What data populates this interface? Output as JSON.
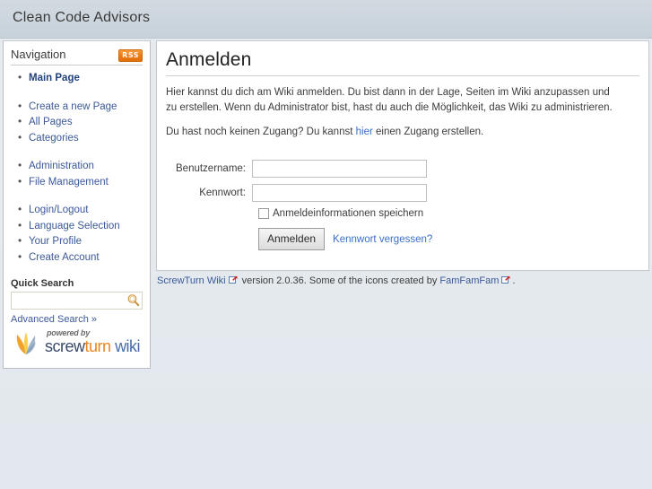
{
  "header": {
    "site_title": "Clean Code Advisors"
  },
  "sidebar": {
    "panel_title": "Navigation",
    "rss_label": "RSS",
    "nav_items": [
      {
        "label": "Main Page",
        "current": true
      },
      {
        "spacer": true
      },
      {
        "label": "Create a new Page",
        "current": false
      },
      {
        "label": "All Pages",
        "current": false
      },
      {
        "label": "Categories",
        "current": false
      },
      {
        "spacer": true
      },
      {
        "label": "Administration",
        "current": false
      },
      {
        "label": "File Management",
        "current": false
      },
      {
        "spacer": true
      },
      {
        "label": "Login/Logout",
        "current": false
      },
      {
        "label": "Language Selection",
        "current": false
      },
      {
        "label": "Your Profile",
        "current": false
      },
      {
        "label": "Create Account",
        "current": false
      }
    ],
    "quick_search_label": "Quick Search",
    "search_value": "",
    "search_placeholder": "",
    "search_icon": "magnifier-icon",
    "advanced_search_label": "Advanced Search »",
    "logo": {
      "powered_by": "powered by",
      "name_part1": "screw",
      "name_part2": "turn",
      "name_part3": "wiki",
      "icon": "screwturn-leaf-logo"
    }
  },
  "main": {
    "page_title": "Anmelden",
    "paragraph1": "Hier kannst du dich am Wiki anmelden. Du bist dann in der Lage, Seiten im Wiki anzupassen und zu erstellen. Wenn du Administrator bist, hast du auch die Möglichkeit, das Wiki zu administrieren.",
    "paragraph2_before": "Du hast noch keinen Zugang? Du kannst ",
    "paragraph2_link": "hier",
    "paragraph2_after": " einen Zugang erstellen.",
    "form": {
      "username_label": "Benutzername:",
      "username_value": "",
      "password_label": "Kennwort:",
      "password_value": "",
      "remember_label": "Anmeldeinformationen speichern",
      "remember_checked": false,
      "submit_label": "Anmelden",
      "forgot_label": "Kennwort vergessen?"
    }
  },
  "footer": {
    "wiki_link": "ScrewTurn Wiki",
    "version_text": " version 2.0.36. Some of the icons created by ",
    "credits_link": "FamFamFam",
    "trailing_text": ".",
    "external_icon": "external-link-icon"
  },
  "colors": {
    "page_background": "#e3e9ee",
    "header_background": "#ccd5dd",
    "panel_background": "#ffffff",
    "link": "#3b5998",
    "accent_rss": "#ef7c16",
    "logo_orange": "#e8861e",
    "logo_blue": "#3a4a6b"
  }
}
